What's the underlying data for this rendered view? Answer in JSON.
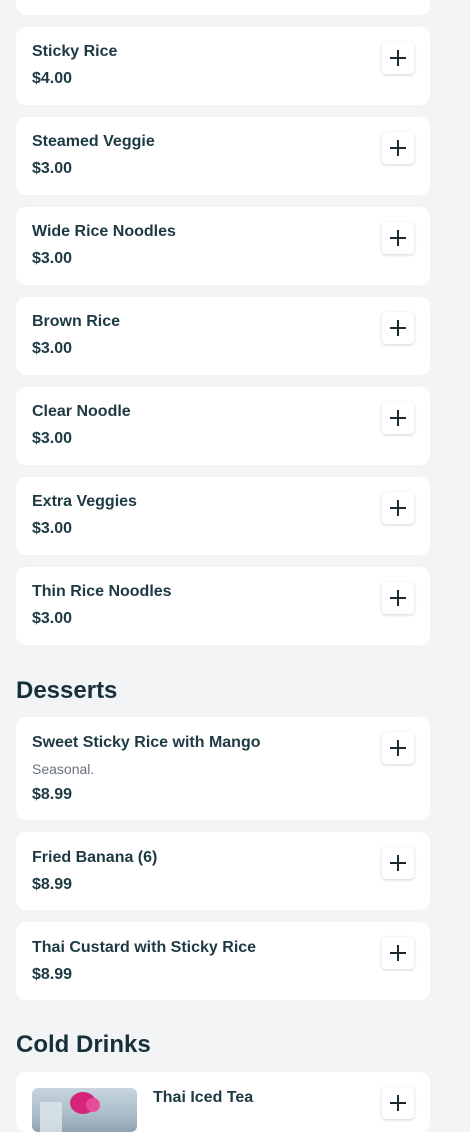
{
  "sides": [
    {
      "name": "Sticky Rice",
      "price": "$4.00"
    },
    {
      "name": "Steamed Veggie",
      "price": "$3.00"
    },
    {
      "name": "Wide Rice Noodles",
      "price": "$3.00"
    },
    {
      "name": "Brown Rice",
      "price": "$3.00"
    },
    {
      "name": "Clear Noodle",
      "price": "$3.00"
    },
    {
      "name": "Extra Veggies",
      "price": "$3.00"
    },
    {
      "name": "Thin Rice Noodles",
      "price": "$3.00"
    }
  ],
  "desserts": {
    "title": "Desserts",
    "items": [
      {
        "name": "Sweet Sticky Rice with Mango",
        "description": "Seasonal.",
        "price": "$8.99"
      },
      {
        "name": "Fried Banana (6)",
        "price": "$8.99"
      },
      {
        "name": "Thai Custard with Sticky Rice",
        "price": "$8.99"
      }
    ]
  },
  "cold_drinks": {
    "title": "Cold Drinks",
    "items": [
      {
        "name": "Thai Iced Tea"
      }
    ]
  },
  "icons": {
    "add": "plus-icon",
    "drink_photo": "drink-photo"
  }
}
